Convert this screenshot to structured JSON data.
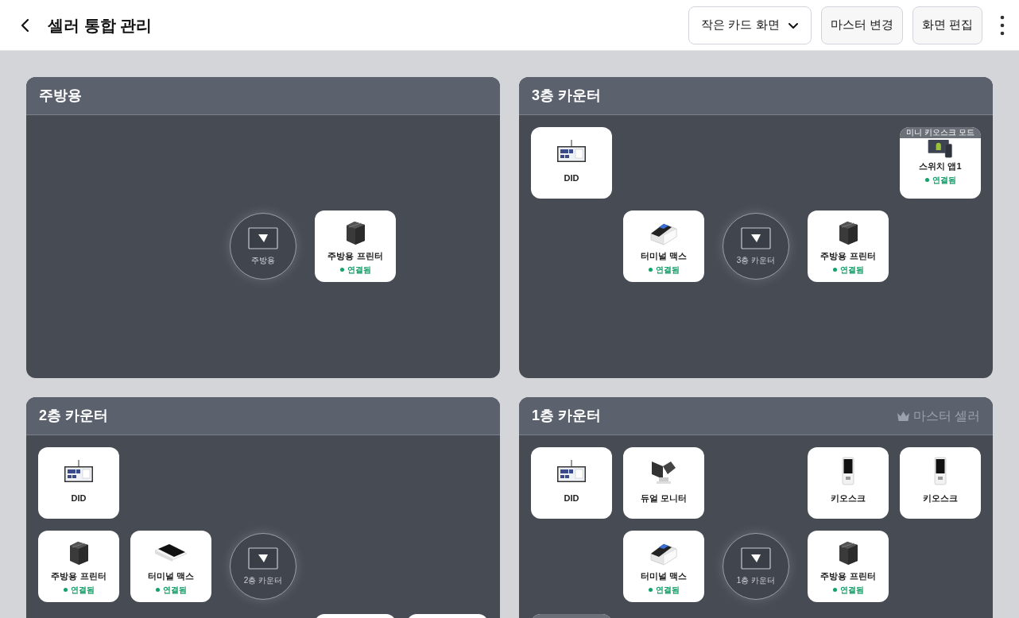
{
  "header": {
    "title": "셀러 통합 관리",
    "view_select": "작은 카드 화면",
    "buttons": [
      "마스터 변경",
      "화면 편집"
    ]
  },
  "panels": [
    {
      "title": "주방용",
      "rows": [
        [
          {
            "kind": "empty"
          },
          {
            "kind": "empty"
          },
          {
            "kind": "empty"
          },
          {
            "kind": "empty"
          },
          {
            "kind": "empty"
          }
        ],
        [
          {
            "kind": "empty"
          },
          {
            "kind": "empty"
          },
          {
            "kind": "hub",
            "label": "주방용"
          },
          {
            "kind": "printer",
            "name": "주방용 프린터",
            "status": "연결됨",
            "connected": true
          },
          {
            "kind": "empty"
          }
        ]
      ]
    },
    {
      "title": "3층 카운터",
      "rows": [
        [
          {
            "kind": "did",
            "name": "DID"
          },
          {
            "kind": "empty"
          },
          {
            "kind": "empty"
          },
          {
            "kind": "empty"
          },
          {
            "kind": "tablet",
            "name": "스위치 앱1",
            "status": "연결됨",
            "connected": true,
            "badge": "미니 키오스크 모드"
          }
        ],
        [
          {
            "kind": "empty"
          },
          {
            "kind": "terminal",
            "name": "터미널 맥스",
            "status": "연결됨",
            "connected": true
          },
          {
            "kind": "hub",
            "label": "3층 카운터"
          },
          {
            "kind": "printer",
            "name": "주방용 프린터",
            "status": "연결됨",
            "connected": true
          },
          {
            "kind": "empty"
          }
        ]
      ]
    },
    {
      "title": "2층 카운터",
      "rows": [
        [
          {
            "kind": "did",
            "name": "DID"
          },
          {
            "kind": "empty"
          },
          {
            "kind": "empty"
          },
          {
            "kind": "empty"
          },
          {
            "kind": "empty"
          }
        ],
        [
          {
            "kind": "printer",
            "name": "주방용 프린터",
            "status": "연결됨",
            "connected": true
          },
          {
            "kind": "handheld",
            "name": "터미널 맥스",
            "status": "연결됨",
            "connected": true
          },
          {
            "kind": "hub",
            "label": "2층 카운터"
          },
          {
            "kind": "empty"
          },
          {
            "kind": "empty"
          }
        ],
        [
          {
            "kind": "empty"
          },
          {
            "kind": "empty"
          },
          {
            "kind": "empty"
          },
          {
            "kind": "blank"
          },
          {
            "kind": "blank"
          }
        ]
      ]
    },
    {
      "title": "1층 카운터",
      "master": "마스터 셀러",
      "rows": [
        [
          {
            "kind": "did",
            "name": "DID"
          },
          {
            "kind": "dual",
            "name": "듀얼 모니터"
          },
          {
            "kind": "empty"
          },
          {
            "kind": "kiosk",
            "name": "키오스크"
          },
          {
            "kind": "kiosk",
            "name": "키오스크"
          }
        ],
        [
          {
            "kind": "empty"
          },
          {
            "kind": "terminal",
            "name": "터미널 맥스",
            "status": "연결됨",
            "connected": true
          },
          {
            "kind": "hub",
            "label": "1층 카운터"
          },
          {
            "kind": "printer",
            "name": "주방용 프린터",
            "status": "연결됨",
            "connected": true
          },
          {
            "kind": "empty"
          }
        ],
        [
          {
            "kind": "blank",
            "banner": true
          },
          {
            "kind": "empty"
          },
          {
            "kind": "empty"
          },
          {
            "kind": "empty"
          },
          {
            "kind": "empty"
          }
        ]
      ]
    }
  ]
}
